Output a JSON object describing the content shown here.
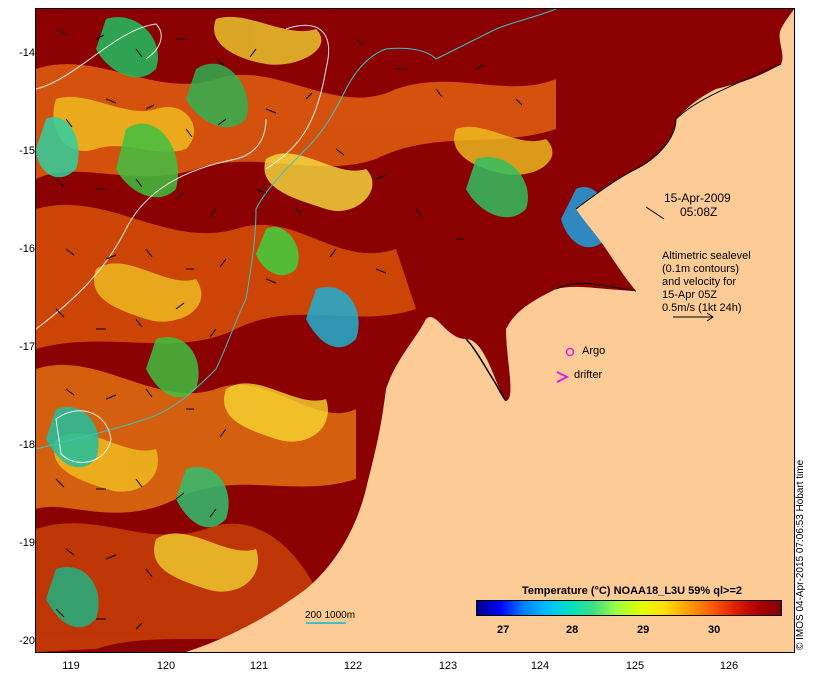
{
  "map": {
    "y_ticks": [
      "-14",
      "-15",
      "-16",
      "-17",
      "-18",
      "-19",
      "-20"
    ],
    "x_ticks": [
      "119",
      "120",
      "121",
      "122",
      "123",
      "124",
      "125",
      "126"
    ],
    "timestamp_date": "15-Apr-2009",
    "timestamp_time": "05:08Z",
    "legend_lines": [
      "Altimetric sealevel",
      "(0.1m contours)",
      "and velocity for",
      "15-Apr 05Z",
      "0.5m/s (1kt 24h)"
    ],
    "argo_label": "Argo",
    "drifter_label": "drifter",
    "scale_label": "200  1000m",
    "colorbar_title": "Temperature (°C) NOAA18_L3U 59% ql>=2",
    "colorbar_ticks": [
      "27",
      "28",
      "29",
      "30"
    ],
    "credit": "© IMOS 04-Apr-2015 07:06:53 Hobart time"
  },
  "colors": {
    "land": "#fccb96",
    "warm": "#8b0000",
    "argo": "#e020e0",
    "drifter": "#e020e0",
    "isobath": "#40c0c0"
  }
}
